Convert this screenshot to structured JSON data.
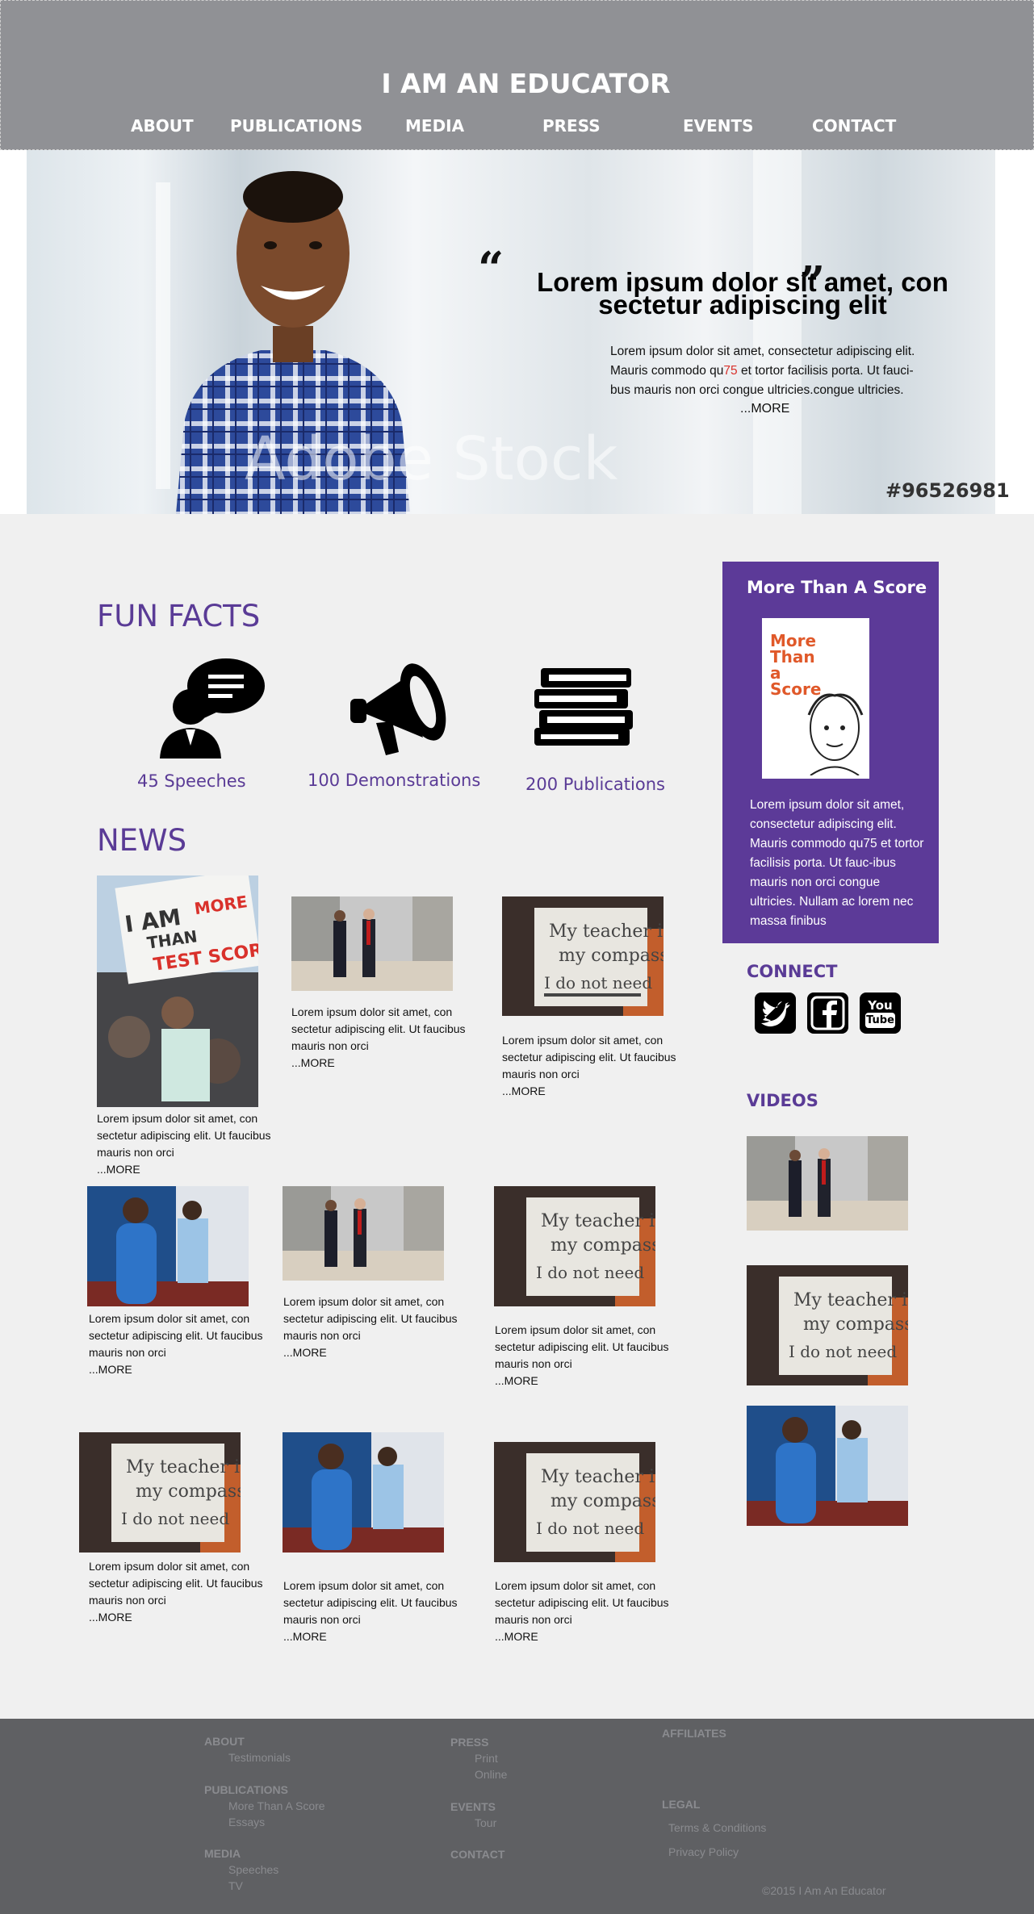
{
  "header": {
    "site_title": "I AM AN EDUCATOR",
    "nav": [
      "ABOUT",
      "PUBLICATIONS",
      "MEDIA",
      "PRESS",
      "EVENTS",
      "CONTACT"
    ]
  },
  "hero": {
    "quote_open": "“",
    "quote_close": "”",
    "headline": "Lorem ipsum dolor sit amet, con sectetur adipiscing elit",
    "body_before": "Lorem ipsum dolor sit amet, consectetur adipiscing elit. Mauris commodo qu",
    "body_highlight": "75",
    "body_after": " et tortor facilisis porta. Ut fauci-bus mauris non orci congue ultricies.congue ultricies.",
    "more": "...MORE",
    "tag": "#96526981",
    "watermark": "Adobe Stock"
  },
  "fun_facts": {
    "title": "FUN FACTS",
    "items": [
      "45 Speeches",
      "100 Demonstrations",
      "200 Publications"
    ]
  },
  "news": {
    "title": "NEWS",
    "caption": "Lorem ipsum dolor sit amet, con sectetur adipiscing elit. Ut faucibus mauris non orci",
    "more": "...MORE"
  },
  "sidebar": {
    "score_title": "More Than A Score",
    "book_title": "More Than a Score",
    "score_body": "Lorem ipsum dolor sit amet, consectetur adipiscing elit. Mauris commodo qu75 et tortor facilisis porta. Ut fauc-ibus mauris non orci congue ultricies. Nullam ac lorem nec massa finibus",
    "connect": "CONNECT",
    "videos": "VIDEOS",
    "youtube_top": "You",
    "youtube_bottom": "Tube"
  },
  "footer": {
    "about": "ABOUT",
    "testimonials": "Testimonials",
    "publications": "PUBLICATIONS",
    "more_than_a_score": "More Than A Score",
    "essays": "Essays",
    "media": "MEDIA",
    "speeches": "Speeches",
    "tv": "TV",
    "press": "PRESS",
    "print": "Print",
    "online": "Online",
    "events": "EVENTS",
    "tour": "Tour",
    "contact": "CONTACT",
    "affiliates": "AFFILIATES",
    "legal": "LEGAL",
    "terms": "Terms & Conditions",
    "privacy": "Privacy Policy",
    "copyright": "©2015 I Am An Educator"
  },
  "colors": {
    "brand_purple": "#5c3a98",
    "header_gray": "#909195",
    "footer_gray": "#5f6063",
    "highlight_red": "#d9312b"
  }
}
